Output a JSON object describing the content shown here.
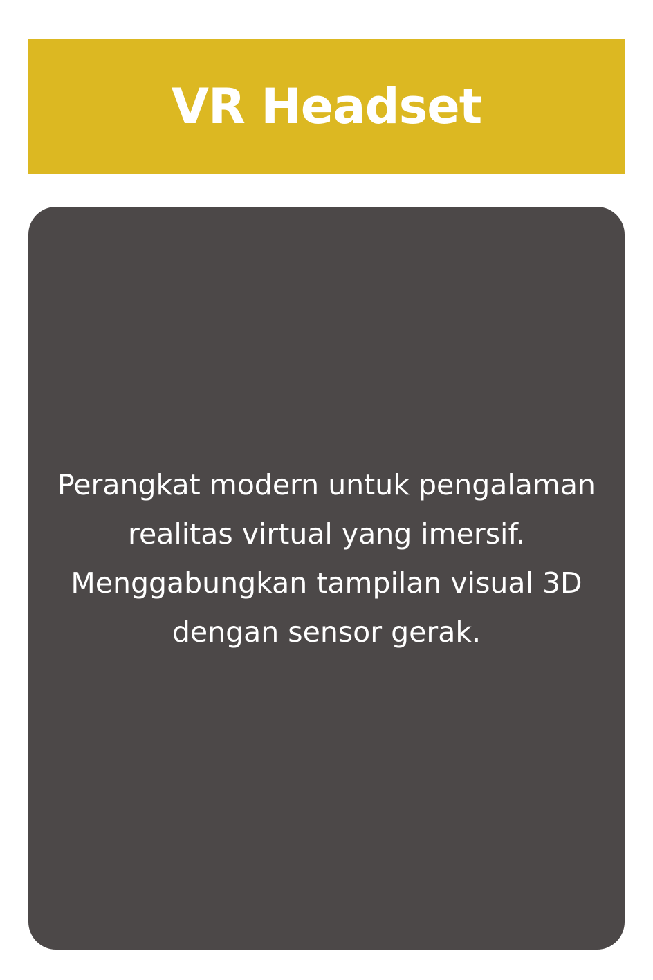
{
  "header": {
    "title": "VR Headset"
  },
  "card": {
    "description": "Perangkat modern untuk pengalaman realitas virtual yang imersif. Menggabungkan tampilan visual 3D dengan sensor gerak."
  },
  "colors": {
    "banner": "#dcb822",
    "card": "#4c4848",
    "text": "#ffffff",
    "background": "#ffffff"
  }
}
